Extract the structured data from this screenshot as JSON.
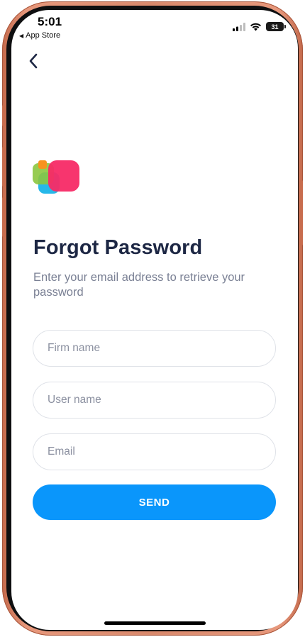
{
  "status_bar": {
    "time": "5:01",
    "back_to_app": "App Store",
    "battery": "31"
  },
  "page": {
    "title": "Forgot Password",
    "subtitle": "Enter your email address to retrieve your password"
  },
  "form": {
    "firm_placeholder": "Firm name",
    "user_placeholder": "User name",
    "email_placeholder": "Email",
    "firm_value": "",
    "user_value": "",
    "email_value": ""
  },
  "actions": {
    "send_label": "SEND"
  },
  "icons": {
    "back": "chevron-left-icon",
    "signal": "cellular-signal-icon",
    "wifi": "wifi-icon",
    "battery": "battery-icon",
    "logo": "app-logo"
  },
  "colors": {
    "accent": "#0a96fb",
    "title": "#1d2744",
    "subtitle": "#7a8094",
    "logo_pink": "#f72a66",
    "logo_green": "#8cc63f",
    "logo_blue": "#1ab4e8",
    "logo_orange": "#f7931e"
  }
}
